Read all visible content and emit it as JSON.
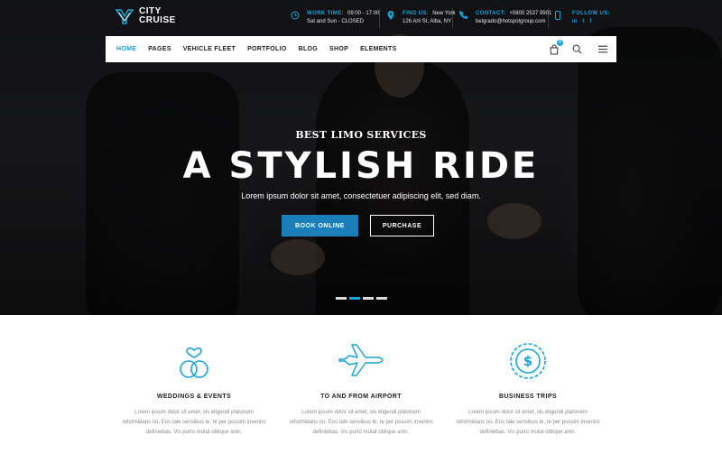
{
  "brand": {
    "line1": "CITY",
    "line2": "CRUISE"
  },
  "top_info": [
    {
      "label": "WORK TIME:",
      "value": "09:00 - 17:00",
      "line2": "Sat and Sun - CLOSED",
      "icon": "clock-icon"
    },
    {
      "label": "FIND US:",
      "value": "New York",
      "line2": "126 Arli St, Alba, NY",
      "icon": "map-pin-icon"
    },
    {
      "label": "CONTACT:",
      "value": "+0800 2537 9901",
      "line2": "belgrado@hotspotgroup.com",
      "icon": "phone-icon"
    }
  ],
  "social": {
    "label": "FOLLOW US:",
    "icons": [
      "in",
      "t",
      "f"
    ]
  },
  "nav": {
    "items": [
      "HOME",
      "PAGES",
      "VEHICLE FLEET",
      "PORTFOLIO",
      "BLOG",
      "SHOP",
      "ELEMENTS"
    ],
    "cart_count": "0"
  },
  "hero": {
    "kicker": "BEST LIMO SERVICES",
    "title": "A STYLISH RIDE",
    "subtitle": "Lorem ipsum dolor sit amet, consectetuer adipiscing elit, sed diam.",
    "book_label": "BOOK ONLINE",
    "purchase_label": "PURCHASE",
    "slides": 4,
    "active_slide": 2
  },
  "features": [
    {
      "title": "WEDDINGS & EVENTS",
      "icon": "rings-heart-icon",
      "line1": "Lorem ipsum dolor sit amet, vis eligendi platonem",
      "line2": "reformidans no. Eos tale sensibus te, te per possim inveniro",
      "line3": "definiebas. Vis purto mutat oblique anin."
    },
    {
      "title": "TO AND FROM AIRPORT",
      "icon": "airplane-icon",
      "line1": "Lorem ipsum dolor sit amet, vis eligendi platonem",
      "line2": "reformidans no. Eos tale sensibus te, te per possim inveniro",
      "line3": "definiebas. Vis purto mutat oblique anin."
    },
    {
      "title": "BUSINESS TRIPS",
      "icon": "dollar-coin-icon",
      "line1": "Lorem ipsum dolor sit amet, vis eligendi platonem",
      "line2": "reformidans no. Eos tale sensibus te, te per possim inveniro",
      "line3": "definiebas. Vis purto mutat oblique anin."
    }
  ],
  "colors": {
    "accent": "#1aa3d8",
    "button": "#1a7fb8"
  }
}
